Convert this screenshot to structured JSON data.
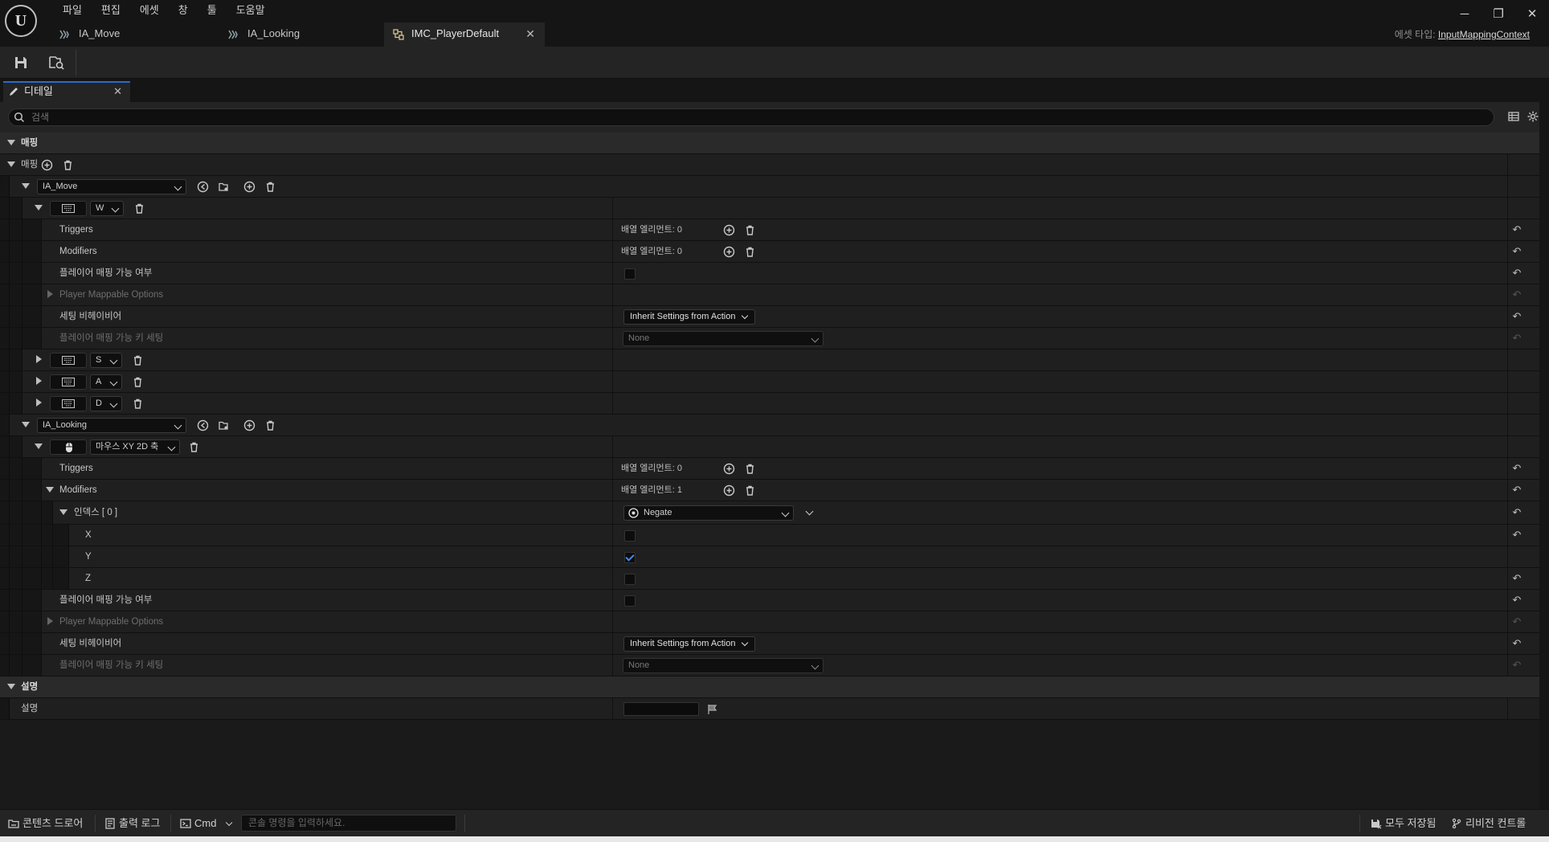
{
  "menu": [
    "파일",
    "편집",
    "에셋",
    "창",
    "툴",
    "도움말"
  ],
  "tabs": [
    {
      "label": "IA_Move",
      "active": false
    },
    {
      "label": "IA_Looking",
      "active": false
    },
    {
      "label": "IMC_PlayerDefault",
      "active": true
    }
  ],
  "asset_type": {
    "label": "에셋 타입:",
    "value": "InputMappingContext"
  },
  "panel_tab": {
    "label": "디테일"
  },
  "search": {
    "placeholder": "검색"
  },
  "rows": {
    "cat_mapping": "매핑",
    "mapping_array": "매핑",
    "ia_move": "IA_Move",
    "key_w": "W",
    "w_triggers": "Triggers",
    "w_triggers_val": "배열 엘리먼트: 0",
    "w_modifiers": "Modifiers",
    "w_modifiers_val": "배열 엘리먼트: 0",
    "w_player_mappable": "플레이어 매핑 가능 여부",
    "w_pmo": "Player Mappable Options",
    "w_setting_behavior": "세팅 비헤이비어",
    "w_setting_behavior_val": "Inherit Settings from Action",
    "w_key_setting": "플레이어 매핑 가능 키 세팅",
    "w_key_setting_val": "None",
    "key_s": "S",
    "key_a": "A",
    "key_d": "D",
    "ia_looking": "IA_Looking",
    "key_mouse": "마우스 XY 2D 축",
    "m_triggers": "Triggers",
    "m_triggers_val": "배열 엘리먼트: 0",
    "m_modifiers": "Modifiers",
    "m_modifiers_val": "배열 엘리먼트: 1",
    "m_index0": "인덱스 [ 0 ]",
    "m_index0_val": "Negate",
    "x": "X",
    "y": "Y",
    "z": "Z",
    "m_player_mappable": "플레이어 매핑 가능 여부",
    "m_pmo": "Player Mappable Options",
    "m_setting_behavior": "세팅 비헤이비어",
    "m_setting_behavior_val": "Inherit Settings from Action",
    "m_key_setting": "플레이어 매핑 가능 키 세팅",
    "m_key_setting_val": "None",
    "cat_desc": "설명",
    "desc": "설명"
  },
  "checks": {
    "w_player_mappable": false,
    "x": false,
    "y": true,
    "z": false,
    "m_player_mappable": false
  },
  "statusbar": {
    "content_drawer": "콘텐츠 드로어",
    "output_log": "출력 로그",
    "cmd": "Cmd",
    "cmd_placeholder": "콘솔 명령을 입력하세요.",
    "save_all": "모두 저장됨",
    "revision": "리비전 컨트롤"
  },
  "colors": {
    "accent": "#2a6ad0",
    "check": "#3d8bff"
  }
}
